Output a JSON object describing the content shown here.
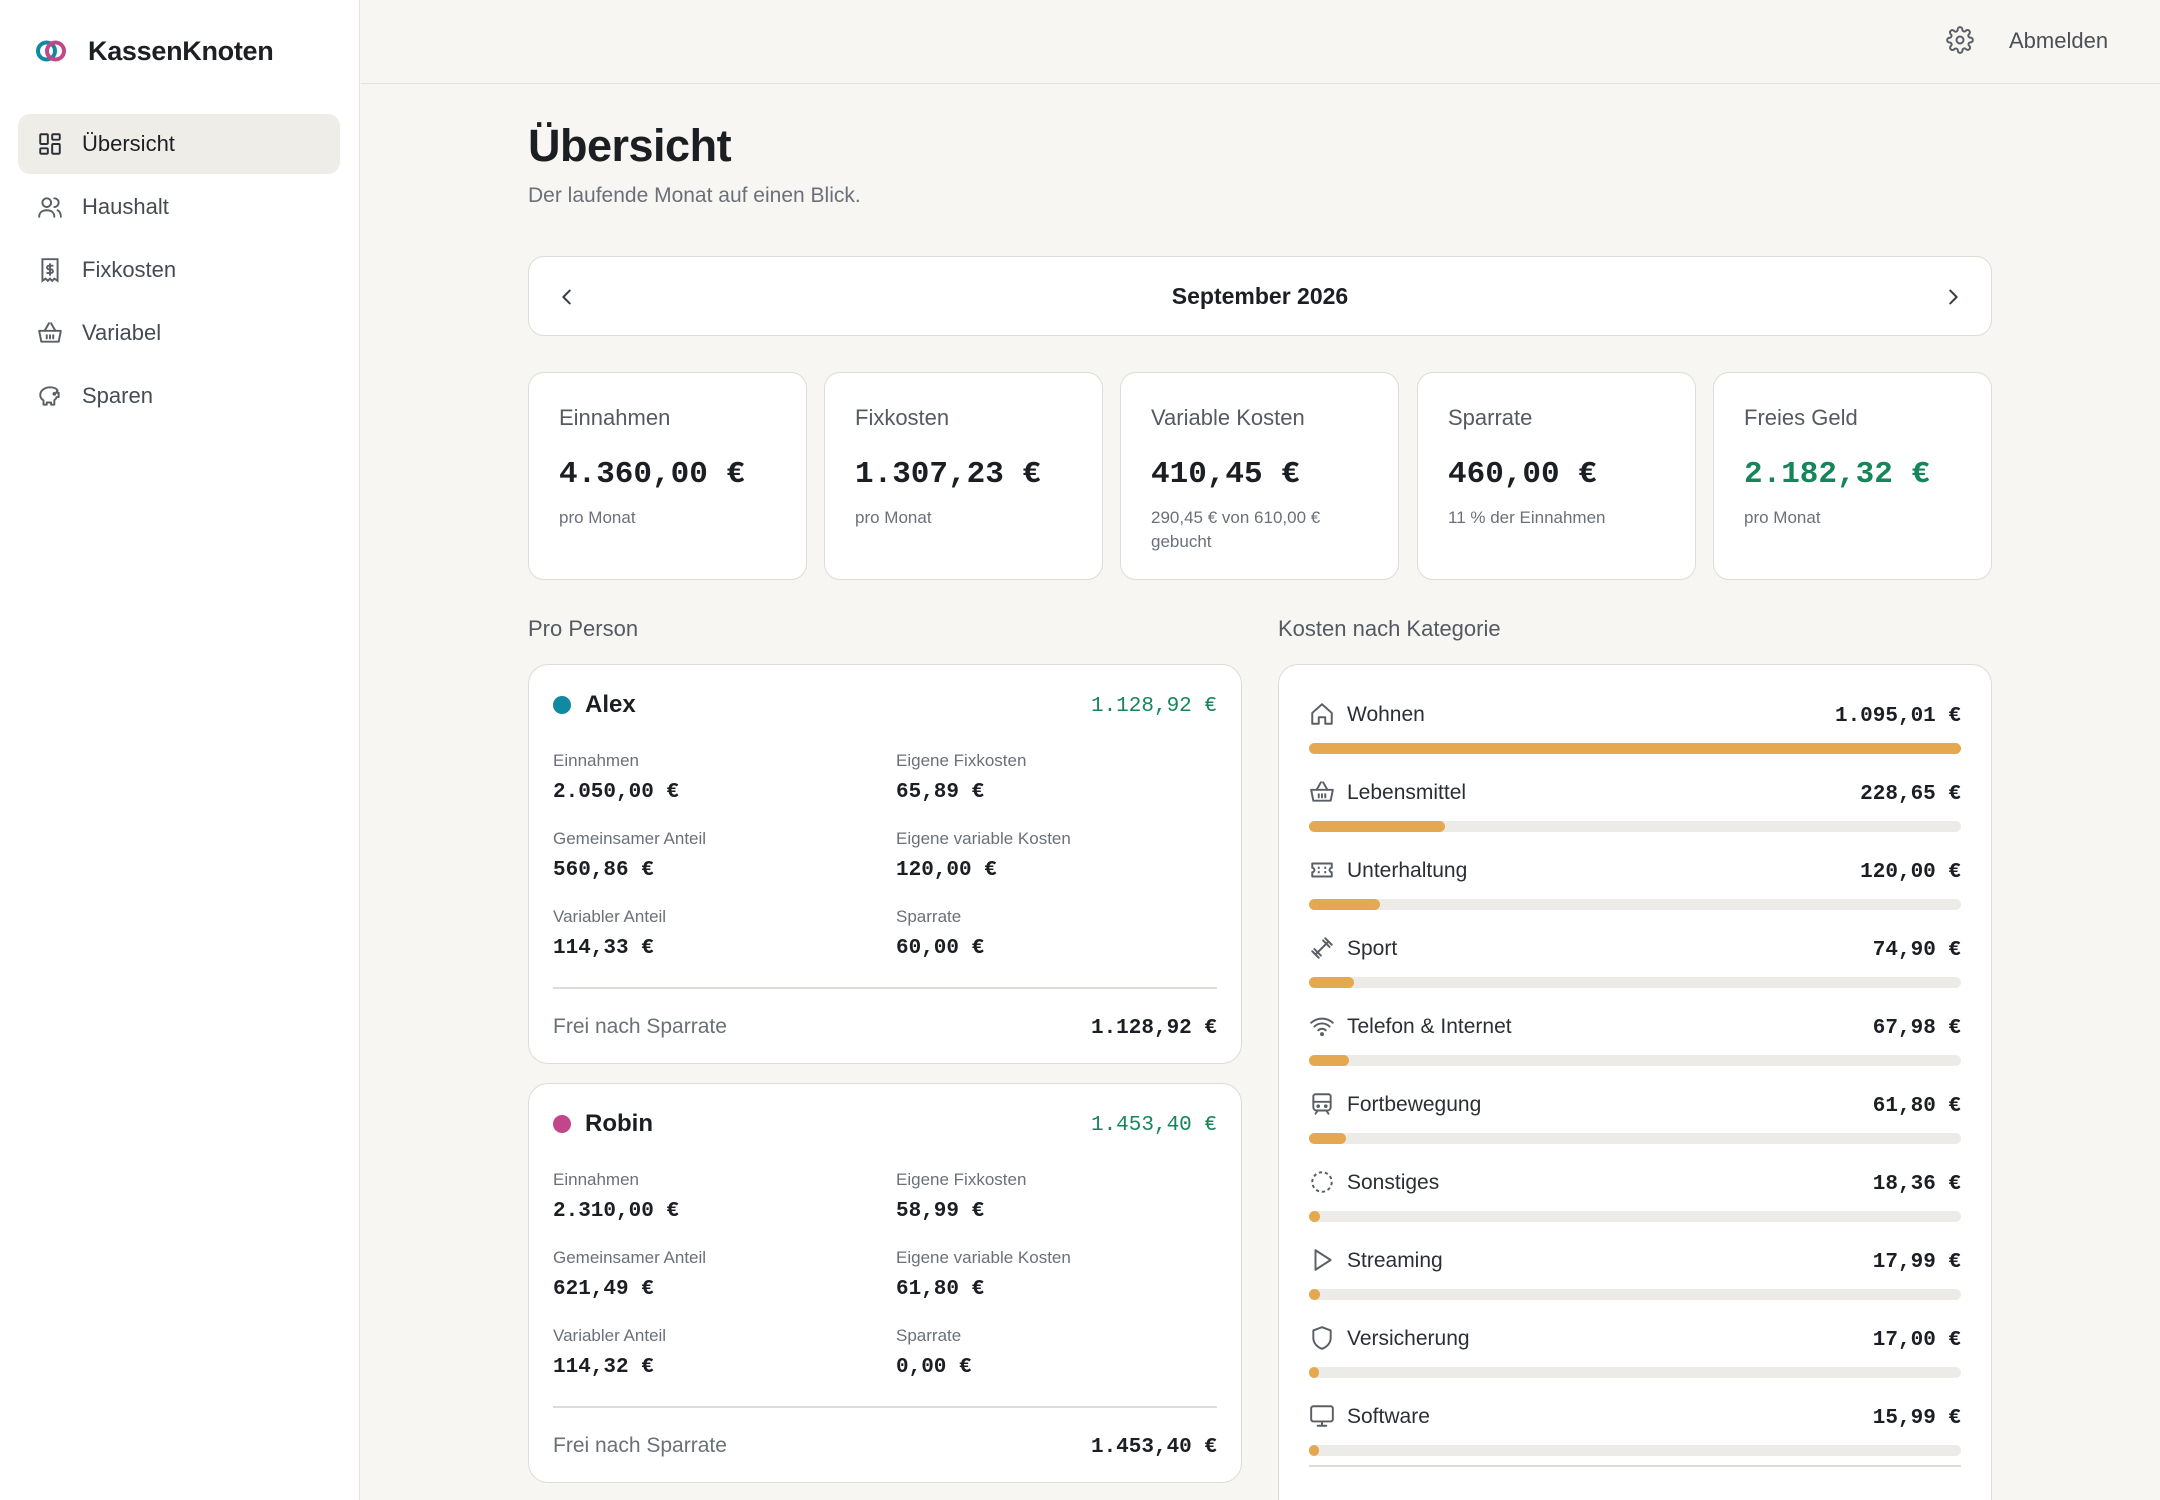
{
  "brand": {
    "name": "KassenKnoten"
  },
  "sidebar": {
    "items": [
      {
        "label": "Übersicht",
        "icon": "dashboard-icon",
        "active": true
      },
      {
        "label": "Haushalt",
        "icon": "users-icon",
        "active": false
      },
      {
        "label": "Fixkosten",
        "icon": "receipt-icon",
        "active": false
      },
      {
        "label": "Variabel",
        "icon": "basket-icon",
        "active": false
      },
      {
        "label": "Sparen",
        "icon": "piggy-bank-icon",
        "active": false
      }
    ]
  },
  "topbar": {
    "settings_icon": "gear-icon",
    "logout_label": "Abmelden"
  },
  "page": {
    "title": "Übersicht",
    "subtitle": "Der laufende Monat auf einen Blick."
  },
  "month": {
    "label": "September 2026"
  },
  "stats": [
    {
      "label": "Einnahmen",
      "value": "4.360,00 €",
      "sub": "pro Monat",
      "highlight": false
    },
    {
      "label": "Fixkosten",
      "value": "1.307,23 €",
      "sub": "pro Monat",
      "highlight": false
    },
    {
      "label": "Variable Kosten",
      "value": "410,45 €",
      "sub": "290,45 € von 610,00 € gebucht",
      "highlight": false
    },
    {
      "label": "Sparrate",
      "value": "460,00 €",
      "sub": "11 % der Einnahmen",
      "highlight": false
    },
    {
      "label": "Freies Geld",
      "value": "2.182,32 €",
      "sub": "pro Monat",
      "highlight": true
    }
  ],
  "sections": {
    "per_person": "Pro Person",
    "by_category": "Kosten nach Kategorie"
  },
  "persons": [
    {
      "name": "Alex",
      "color": "#0f8aa1",
      "total": "1.128,92 €",
      "fields": [
        {
          "label": "Einnahmen",
          "value": "2.050,00 €"
        },
        {
          "label": "Eigene Fixkosten",
          "value": "65,89 €"
        },
        {
          "label": "Gemeinsamer Anteil",
          "value": "560,86 €"
        },
        {
          "label": "Eigene variable Kosten",
          "value": "120,00 €"
        },
        {
          "label": "Variabler Anteil",
          "value": "114,33 €"
        },
        {
          "label": "Sparrate",
          "value": "60,00 €"
        }
      ],
      "free_label": "Frei nach Sparrate",
      "free_value": "1.128,92 €"
    },
    {
      "name": "Robin",
      "color": "#c2468a",
      "total": "1.453,40 €",
      "fields": [
        {
          "label": "Einnahmen",
          "value": "2.310,00 €"
        },
        {
          "label": "Eigene Fixkosten",
          "value": "58,99 €"
        },
        {
          "label": "Gemeinsamer Anteil",
          "value": "621,49 €"
        },
        {
          "label": "Eigene variable Kosten",
          "value": "61,80 €"
        },
        {
          "label": "Variabler Anteil",
          "value": "114,32 €"
        },
        {
          "label": "Sparrate",
          "value": "0,00 €"
        }
      ],
      "free_label": "Frei nach Sparrate",
      "free_value": "1.453,40 €"
    }
  ],
  "categories": [
    {
      "name": "Wohnen",
      "amount": "1.095,01 €",
      "value": 1095.01,
      "icon": "home-icon"
    },
    {
      "name": "Lebensmittel",
      "amount": "228,65 €",
      "value": 228.65,
      "icon": "basket-icon"
    },
    {
      "name": "Unterhaltung",
      "amount": "120,00 €",
      "value": 120.0,
      "icon": "ticket-icon"
    },
    {
      "name": "Sport",
      "amount": "74,90 €",
      "value": 74.9,
      "icon": "dumbbell-icon"
    },
    {
      "name": "Telefon & Internet",
      "amount": "67,98 €",
      "value": 67.98,
      "icon": "wifi-icon"
    },
    {
      "name": "Fortbewegung",
      "amount": "61,80 €",
      "value": 61.8,
      "icon": "train-icon"
    },
    {
      "name": "Sonstiges",
      "amount": "18,36 €",
      "value": 18.36,
      "icon": "dashed-circle-icon"
    },
    {
      "name": "Streaming",
      "amount": "17,99 €",
      "value": 17.99,
      "icon": "play-icon"
    },
    {
      "name": "Versicherung",
      "amount": "17,00 €",
      "value": 17.0,
      "icon": "shield-icon"
    },
    {
      "name": "Software",
      "amount": "15,99 €",
      "value": 15.99,
      "icon": "monitor-icon"
    }
  ],
  "colors": {
    "accent_green": "#16865a",
    "bar": "#e4a851",
    "track": "#ecebe7"
  }
}
